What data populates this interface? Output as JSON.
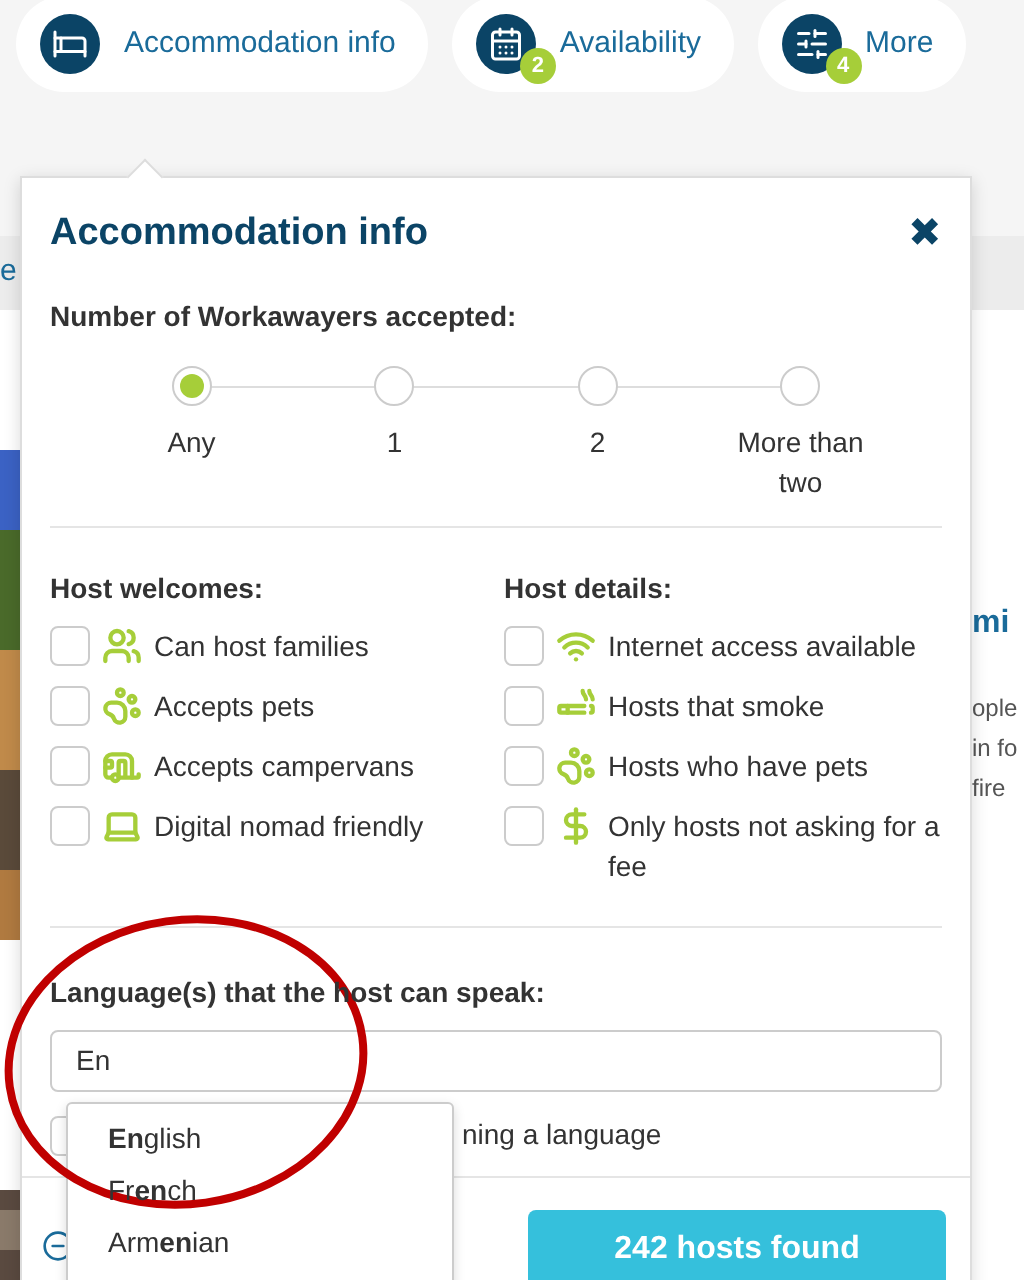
{
  "filter_tabs": [
    {
      "label": "Accommodation info"
    },
    {
      "label": "Availability",
      "badge": "2"
    },
    {
      "label": "More",
      "badge": "4"
    }
  ],
  "background": {
    "left_fragment": "e",
    "right_heading": "mi",
    "right_lines": [
      "ople",
      "in fo",
      "fire"
    ]
  },
  "panel": {
    "title": "Accommodation info",
    "close": "✖",
    "workawayers": {
      "label": "Number of Workawayers accepted:",
      "options": [
        {
          "label": "Any",
          "selected": true
        },
        {
          "label": "1",
          "selected": false
        },
        {
          "label": "2",
          "selected": false
        },
        {
          "label": "More than two",
          "selected": false
        }
      ]
    },
    "host_welcomes": {
      "label": "Host welcomes:",
      "items": [
        {
          "label": "Can host families",
          "checked": false
        },
        {
          "label": "Accepts pets",
          "checked": false
        },
        {
          "label": "Accepts campervans",
          "checked": false
        },
        {
          "label": "Digital nomad friendly",
          "checked": false
        }
      ]
    },
    "host_details": {
      "label": "Host details:",
      "items": [
        {
          "label": "Internet access available",
          "checked": false
        },
        {
          "label": "Hosts that smoke",
          "checked": false
        },
        {
          "label": "Hosts who have pets",
          "checked": false
        },
        {
          "label": "Only hosts not asking for a fee",
          "checked": false
        }
      ]
    },
    "language": {
      "label": "Language(s) that the host can speak:",
      "value": "En",
      "suggestions": [
        "**En**glish",
        "Fr**en**ch",
        "Arm**en**ian"
      ],
      "option": {
        "label": "ning a language",
        "checked": false
      }
    },
    "results_button": "242 hosts found"
  }
}
